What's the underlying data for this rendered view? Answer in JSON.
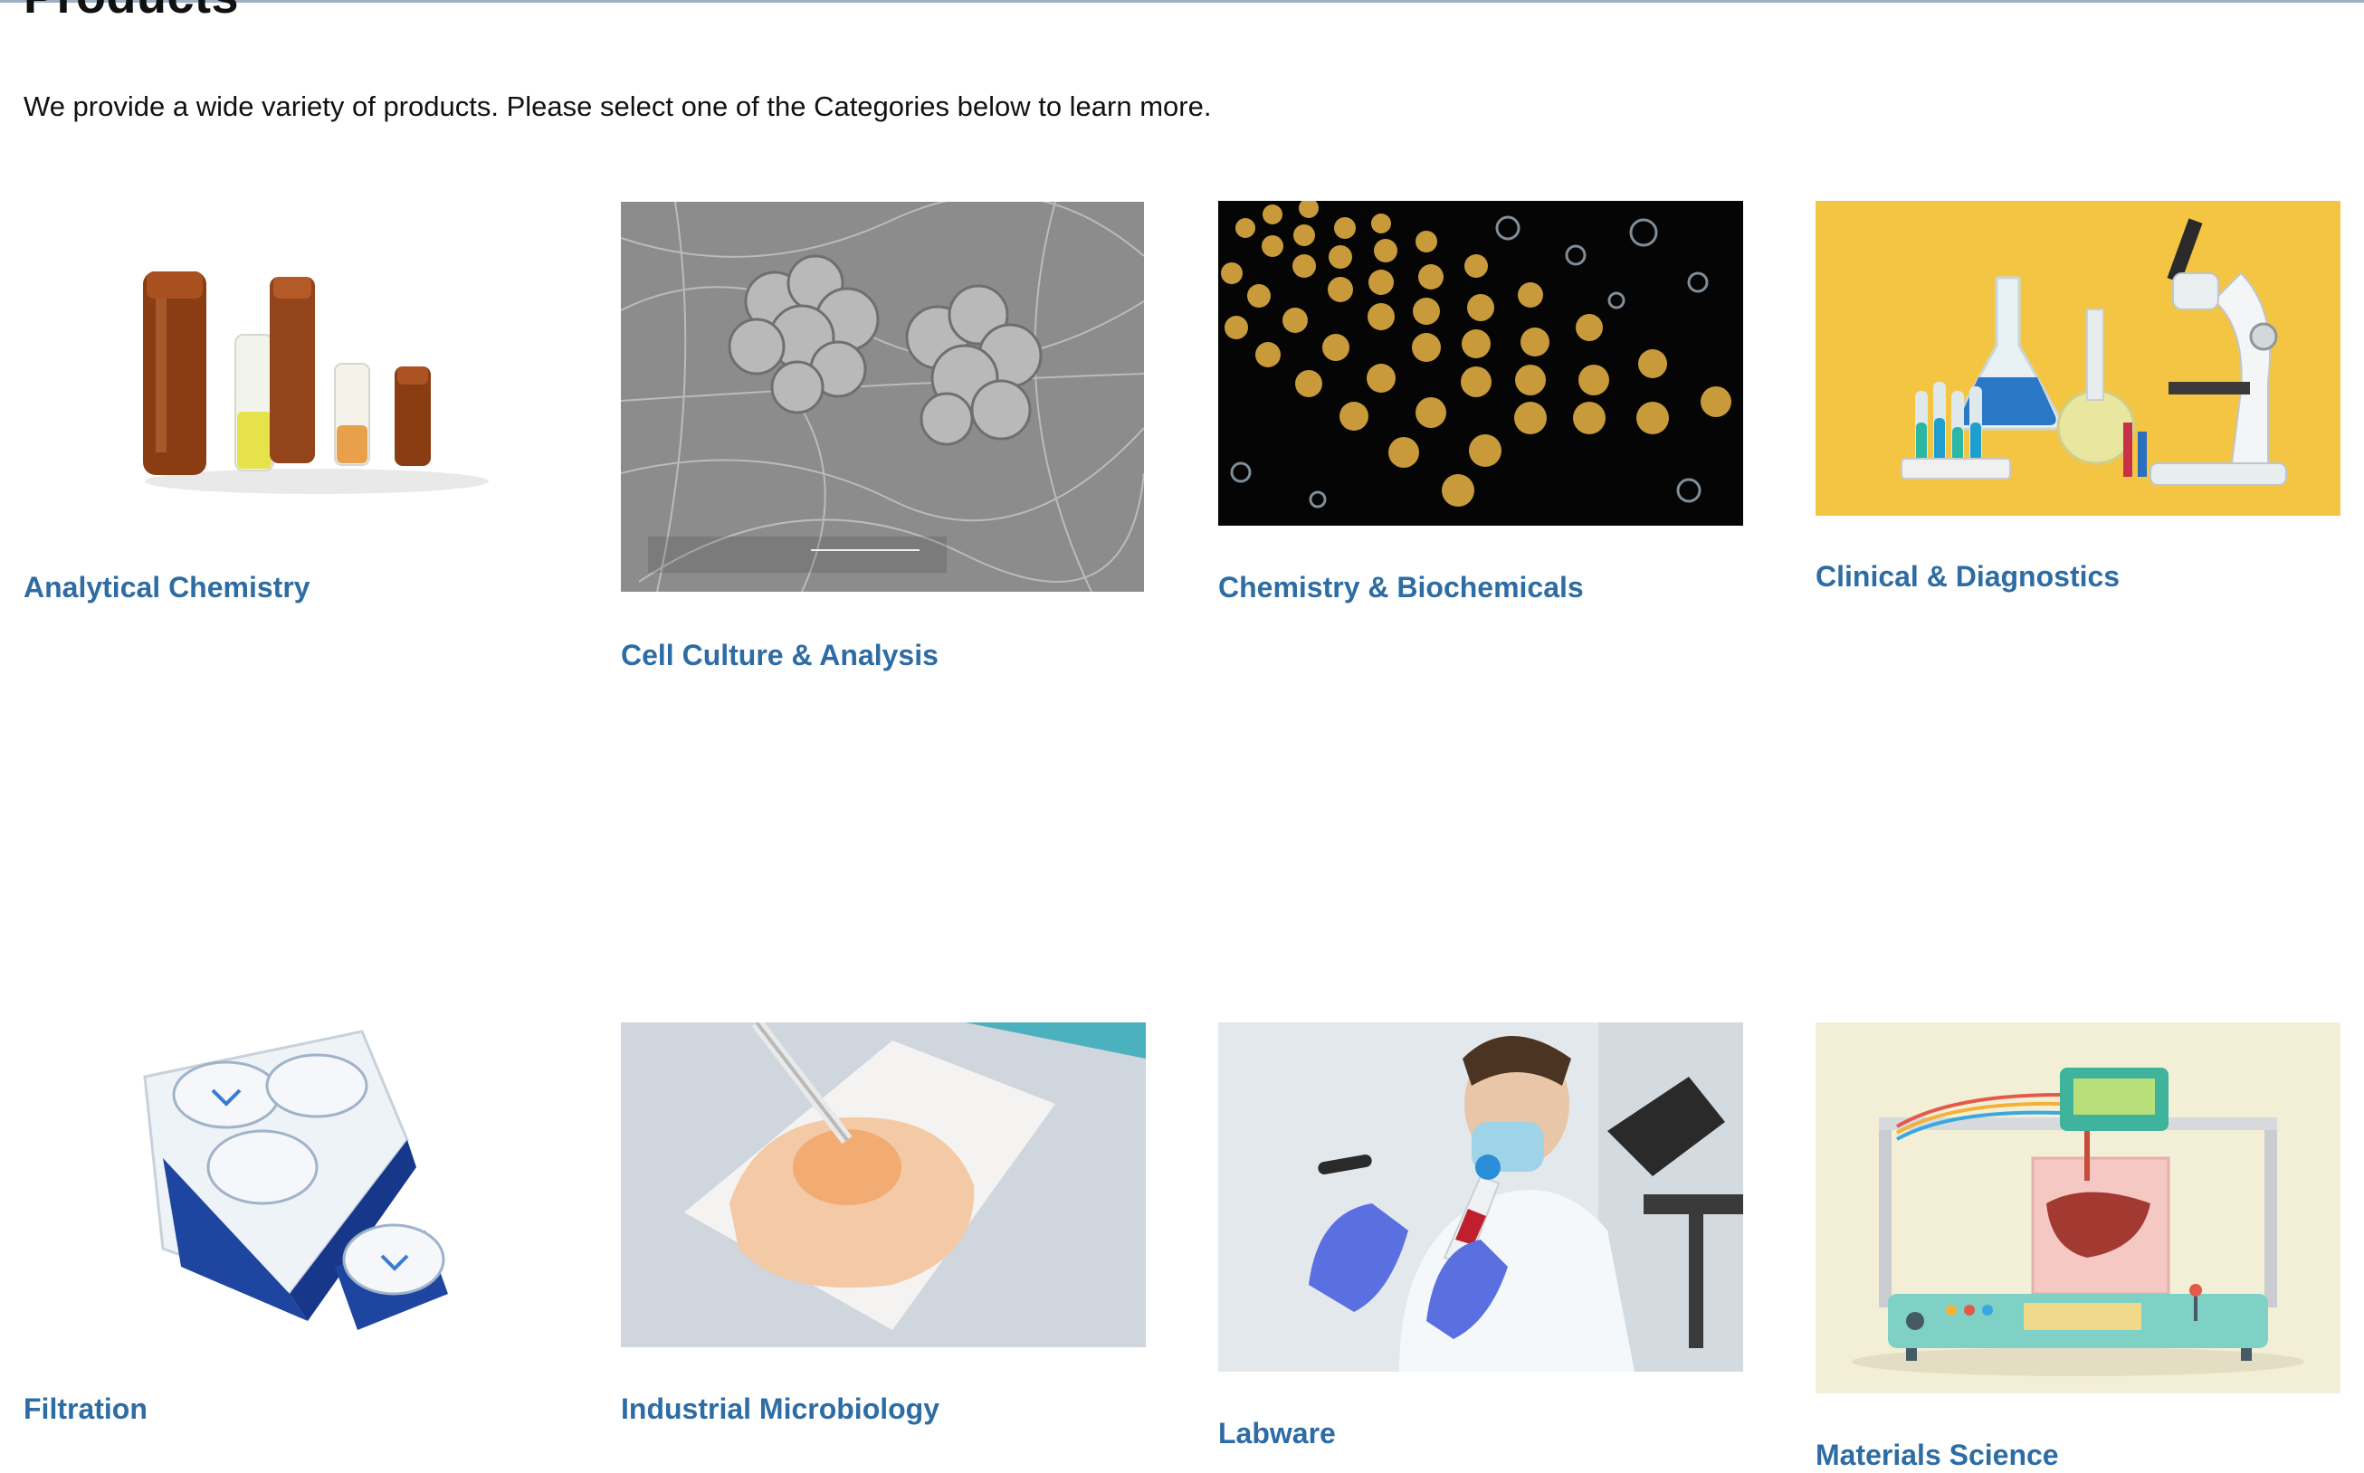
{
  "page": {
    "title": "Products",
    "intro": "We provide a wide variety of products. Please select one of the Categories below to learn more."
  },
  "categories": [
    {
      "label": "Analytical Chemistry",
      "image": "amber-vials-photo"
    },
    {
      "label": "Cell Culture & Analysis",
      "image": "electron-micrograph-cells"
    },
    {
      "label": "Chemistry & Biochemicals",
      "image": "molecular-lattice-render"
    },
    {
      "label": "Clinical & Diagnostics",
      "image": "lab-glassware-microscope-illustration"
    },
    {
      "label": "Filtration",
      "image": "filter-cassettes-photo"
    },
    {
      "label": "Industrial Microbiology",
      "image": "pipette-on-membrane-photo"
    },
    {
      "label": "Labware",
      "image": "scientist-with-test-tube-photo"
    },
    {
      "label": "Materials Science",
      "image": "bioprinter-illustration"
    }
  ],
  "colors": {
    "link": "#2e6ca4",
    "text": "#111111",
    "clinical_bg": "#f4c542",
    "materials_bg": "#f3efd6"
  }
}
